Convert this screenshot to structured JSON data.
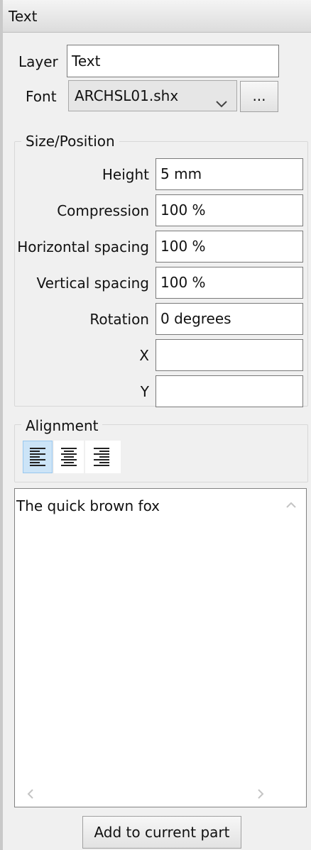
{
  "panel": {
    "title": "Text"
  },
  "layer": {
    "label": "Layer",
    "value": "Text"
  },
  "font": {
    "label": "Font",
    "selected": "ARCHSL01.shx",
    "browse_label": "..."
  },
  "size_position": {
    "legend": "Size/Position",
    "height": {
      "label": "Height",
      "value": "5 mm"
    },
    "compression": {
      "label": "Compression",
      "value": "100 %"
    },
    "horizontal_spacing": {
      "label": "Horizontal spacing",
      "value": "100 %"
    },
    "vertical_spacing": {
      "label": "Vertical spacing",
      "value": "100 %"
    },
    "rotation": {
      "label": "Rotation",
      "value": "0 degrees"
    },
    "x": {
      "label": "X",
      "value": ""
    },
    "y": {
      "label": "Y",
      "value": ""
    }
  },
  "alignment": {
    "legend": "Alignment",
    "options": [
      "align-left",
      "align-center",
      "align-right"
    ],
    "selected": "align-left"
  },
  "text_content": "The quick brown fox",
  "actions": {
    "add_label": "Add to current part"
  },
  "colors": {
    "selected_bg": "#cce4f7",
    "selected_border": "#99c8ef"
  }
}
